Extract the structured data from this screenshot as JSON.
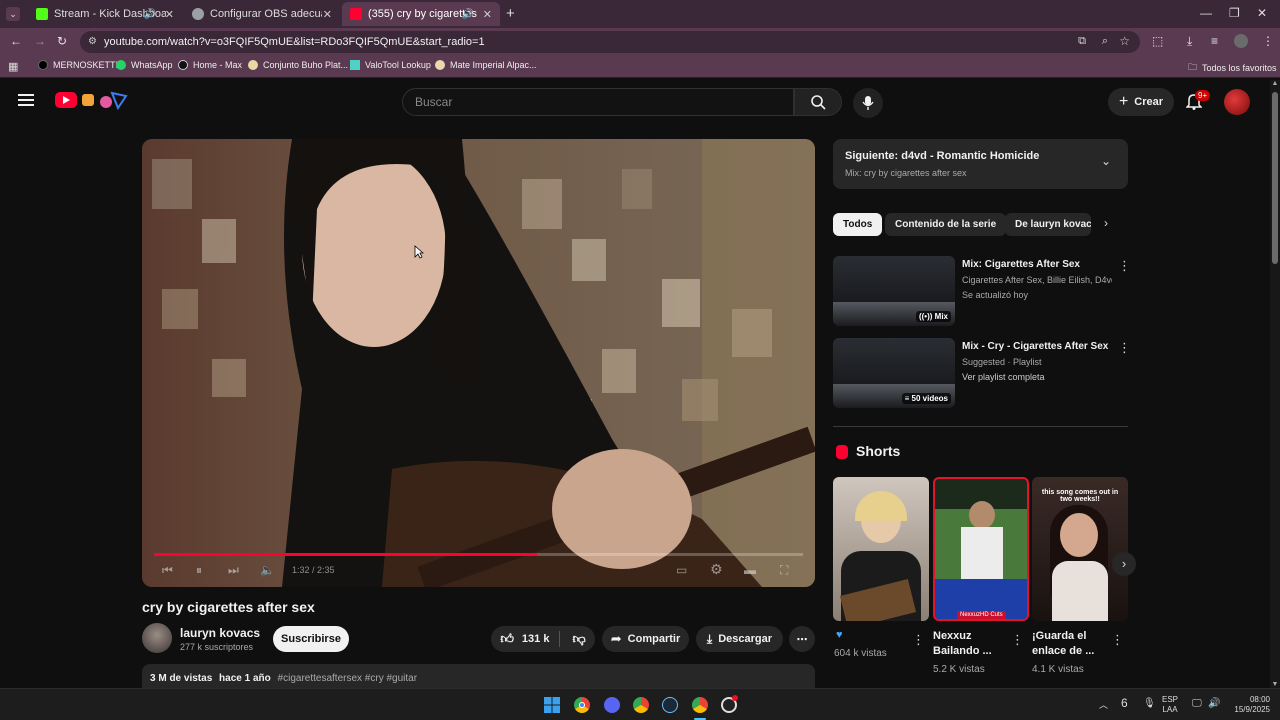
{
  "browser": {
    "tabs": [
      {
        "title": "Stream - Kick Dashboard",
        "color": "#53fc18"
      },
      {
        "title": "Configurar OBS adecuadamente",
        "color": "#9aa0a6"
      },
      {
        "title": "(355) cry by cigarettes after sex",
        "color": "#ff0033"
      }
    ],
    "url": "youtube.com/watch?v=o3FQIF5QmUE&list=RDo3FQIF5QmUE&start_radio=1",
    "bookmarks": [
      "MERNOSKETTI",
      "WhatsApp",
      "Home - Max",
      "Conjunto Buho Plat...",
      "ValoTool Lookup",
      "Mate Imperial Alpac..."
    ],
    "all_bookmarks": "Todos los favoritos"
  },
  "header": {
    "search_placeholder": "Buscar",
    "create_label": "Crear",
    "notifications": "9+"
  },
  "video": {
    "title": "cry by cigarettes after sex",
    "channel": "lauryn kovacs",
    "subscribers": "277 k suscriptores",
    "subscribe_label": "Suscribirse",
    "likes": "131 k",
    "share_label": "Compartir",
    "download_label": "Descargar",
    "time": "1:32 / 2:35",
    "progress": 0.59,
    "views": "3 M de vistas",
    "age": "hace 1 año",
    "tags": "#cigarettesaftersex #cry #guitar"
  },
  "next": {
    "title": "Siguiente: d4vd - Romantic Homicide",
    "sub": "Mix: cry by cigarettes after sex"
  },
  "chips": [
    "Todos",
    "Contenido de la serie",
    "De lauryn kovacs"
  ],
  "playlist": [
    {
      "title": "Mix: Cigarettes After Sex",
      "line1": "Cigarettes After Sex, Billie Eilish, D4vd y ...",
      "line2": "Se actualizó hoy",
      "badge": "Mix"
    },
    {
      "title": "Mix - Cry - Cigarettes After Sex",
      "line1": "Suggested · Playlist",
      "line2": "Ver playlist completa",
      "badge": "50 videos"
    }
  ],
  "shorts": {
    "heading": "Shorts",
    "items": [
      {
        "title": "",
        "views": "604 k vistas"
      },
      {
        "title1": "Nexxuz",
        "title2": "Bailando ...",
        "views": "5.2 K vistas"
      },
      {
        "title1": "¡Guarda el",
        "title2": "enlace de ...",
        "views": "4.1 K vistas"
      }
    ],
    "short3_caption": "this song comes out in two weeks!!",
    "short2_caption": "NexxuzHD Cuts"
  },
  "taskbar": {
    "lang1": "ESP",
    "lang2": "LAA",
    "time": "08:00",
    "date": "15/9/2025",
    "weather": "6"
  }
}
